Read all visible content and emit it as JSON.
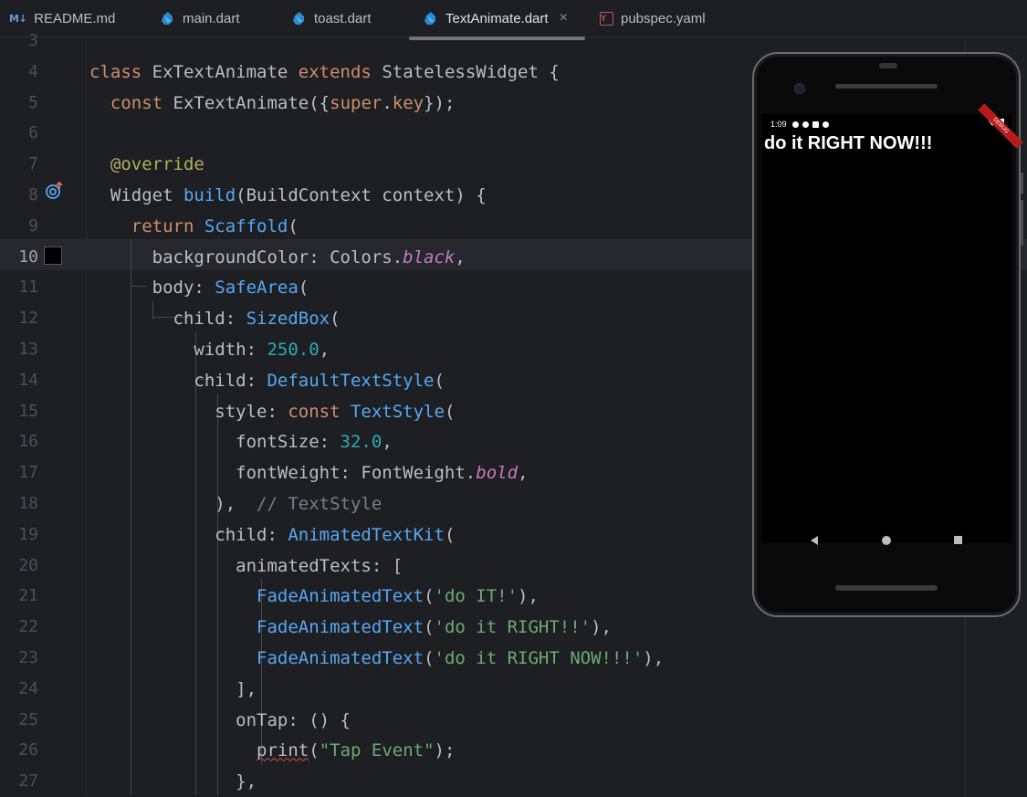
{
  "tabs": [
    {
      "label": "README.md",
      "icon": "markdown-icon",
      "badge": "M↓"
    },
    {
      "label": "main.dart",
      "icon": "dart-icon"
    },
    {
      "label": "toast.dart",
      "icon": "dart-icon"
    },
    {
      "label": "TextAnimate.dart",
      "icon": "dart-icon",
      "active": true,
      "close": "×"
    },
    {
      "label": "pubspec.yaml",
      "icon": "yaml-icon",
      "badge": "Y"
    }
  ],
  "editor": {
    "current_line": 10,
    "lines": [
      {
        "n": "3",
        "tokens": []
      },
      {
        "n": "4",
        "tokens": [
          [
            "kw",
            "class "
          ],
          [
            "t",
            "ExTextAnimate "
          ],
          [
            "kw",
            "extends "
          ],
          [
            "t",
            "StatelessWidget {"
          ]
        ]
      },
      {
        "n": "5",
        "tokens": [
          [
            "t",
            "  "
          ],
          [
            "kw",
            "const "
          ],
          [
            "t",
            "ExTextAnimate({"
          ],
          [
            "kw",
            "super"
          ],
          [
            "t",
            "."
          ],
          [
            "kw",
            "key"
          ],
          [
            "t",
            "});"
          ]
        ]
      },
      {
        "n": "6",
        "tokens": []
      },
      {
        "n": "7",
        "tokens": [
          [
            "t",
            "  "
          ],
          [
            "ann",
            "@override"
          ]
        ]
      },
      {
        "n": "8",
        "tokens": [
          [
            "t",
            "  Widget "
          ],
          [
            "fn",
            "build"
          ],
          [
            "t",
            "(BuildContext context) {"
          ]
        ]
      },
      {
        "n": "9",
        "tokens": [
          [
            "t",
            "    "
          ],
          [
            "kw",
            "return "
          ],
          [
            "fn",
            "Scaffold"
          ],
          [
            "t",
            "("
          ]
        ]
      },
      {
        "n": "10",
        "tokens": [
          [
            "t",
            "      backgroundColor: Colors."
          ],
          [
            "ital",
            "black"
          ],
          [
            "t",
            ","
          ]
        ]
      },
      {
        "n": "11",
        "tokens": [
          [
            "t",
            "      body: "
          ],
          [
            "fn",
            "SafeArea"
          ],
          [
            "t",
            "("
          ]
        ]
      },
      {
        "n": "12",
        "tokens": [
          [
            "t",
            "        child: "
          ],
          [
            "fn",
            "SizedBox"
          ],
          [
            "t",
            "("
          ]
        ]
      },
      {
        "n": "13",
        "tokens": [
          [
            "t",
            "          width: "
          ],
          [
            "num",
            "250.0"
          ],
          [
            "t",
            ","
          ]
        ]
      },
      {
        "n": "14",
        "tokens": [
          [
            "t",
            "          child: "
          ],
          [
            "fn",
            "DefaultTextStyle"
          ],
          [
            "t",
            "("
          ]
        ]
      },
      {
        "n": "15",
        "tokens": [
          [
            "t",
            "            style: "
          ],
          [
            "kw",
            "const "
          ],
          [
            "fn",
            "TextStyle"
          ],
          [
            "t",
            "("
          ]
        ]
      },
      {
        "n": "16",
        "tokens": [
          [
            "t",
            "              fontSize: "
          ],
          [
            "num",
            "32.0"
          ],
          [
            "t",
            ","
          ]
        ]
      },
      {
        "n": "17",
        "tokens": [
          [
            "t",
            "              fontWeight: FontWeight."
          ],
          [
            "ital",
            "bold"
          ],
          [
            "t",
            ","
          ]
        ]
      },
      {
        "n": "18",
        "tokens": [
          [
            "t",
            "            ),  "
          ],
          [
            "cm",
            "// TextStyle"
          ]
        ]
      },
      {
        "n": "19",
        "tokens": [
          [
            "t",
            "            child: "
          ],
          [
            "fn",
            "AnimatedTextKit"
          ],
          [
            "t",
            "("
          ]
        ]
      },
      {
        "n": "20",
        "tokens": [
          [
            "t",
            "              animatedTexts: ["
          ]
        ]
      },
      {
        "n": "21",
        "tokens": [
          [
            "t",
            "                "
          ],
          [
            "fn",
            "FadeAnimatedText"
          ],
          [
            "t",
            "("
          ],
          [
            "str",
            "'do IT!'"
          ],
          [
            "t",
            "),"
          ]
        ]
      },
      {
        "n": "22",
        "tokens": [
          [
            "t",
            "                "
          ],
          [
            "fn",
            "FadeAnimatedText"
          ],
          [
            "t",
            "("
          ],
          [
            "str",
            "'do it RIGHT!!'"
          ],
          [
            "t",
            "),"
          ]
        ]
      },
      {
        "n": "23",
        "tokens": [
          [
            "t",
            "                "
          ],
          [
            "fn",
            "FadeAnimatedText"
          ],
          [
            "t",
            "("
          ],
          [
            "str",
            "'do it RIGHT NOW!!!'"
          ],
          [
            "t",
            "),"
          ]
        ]
      },
      {
        "n": "24",
        "tokens": [
          [
            "t",
            "              ],"
          ]
        ]
      },
      {
        "n": "25",
        "tokens": [
          [
            "t",
            "              onTap: () {"
          ]
        ]
      },
      {
        "n": "26",
        "tokens": [
          [
            "t",
            "                "
          ],
          [
            "sq",
            "print"
          ],
          [
            "t",
            "("
          ],
          [
            "str",
            "\"Tap Event\""
          ],
          [
            "t",
            ");"
          ]
        ]
      },
      {
        "n": "27",
        "tokens": [
          [
            "t",
            "              },"
          ]
        ]
      }
    ]
  },
  "emulator": {
    "status_time": "1:09",
    "debug_banner": "DEBUG",
    "app_text": "do it RIGHT NOW!!!"
  }
}
